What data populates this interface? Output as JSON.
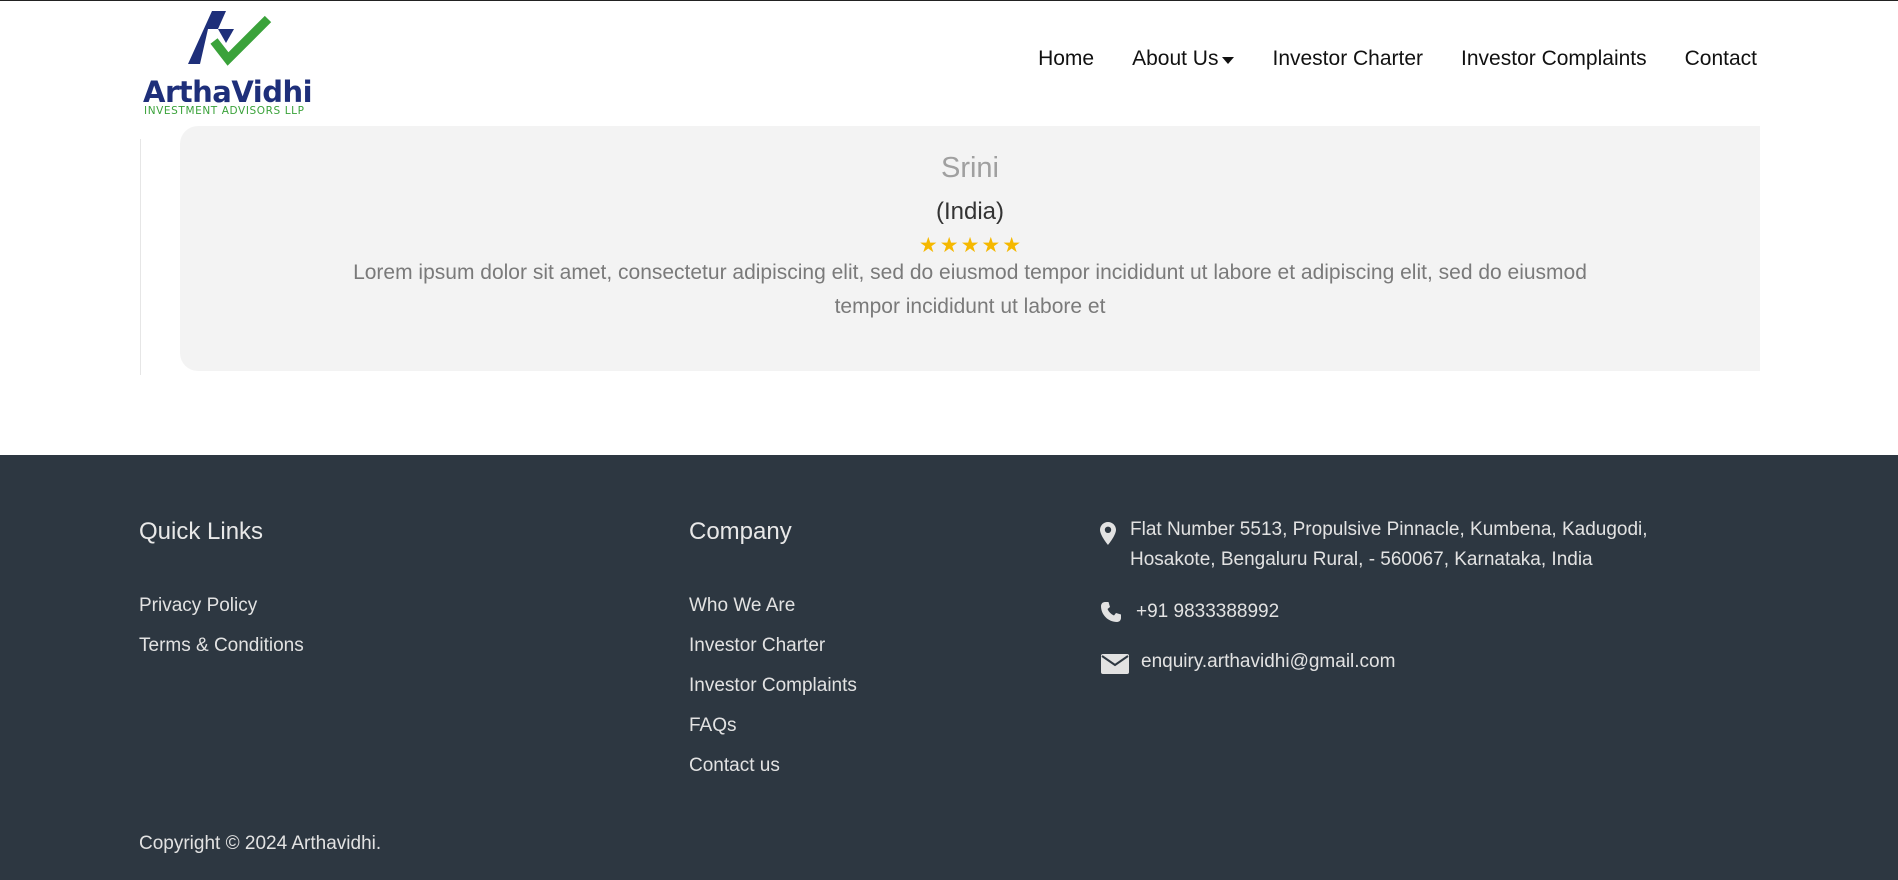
{
  "header": {
    "logo": {
      "name": "ArthaVidhi",
      "subtitle": "INVESTMENT ADVISORS LLP"
    },
    "nav": [
      {
        "label": "Home"
      },
      {
        "label": "About Us"
      },
      {
        "label": "Investor Charter"
      },
      {
        "label": "Investor Complaints"
      },
      {
        "label": "Contact"
      }
    ]
  },
  "testimonial": {
    "name": "Srini",
    "country": "(India)",
    "rating": 5,
    "text": "Lorem ipsum dolor sit amet, consectetur adipiscing elit, sed do eiusmod tempor incididunt ut labore et adipiscing elit, sed do eiusmod tempor incididunt ut labore et"
  },
  "footer": {
    "quick_links": {
      "title": "Quick Links",
      "items": [
        "Privacy Policy",
        "Terms & Conditions"
      ]
    },
    "company": {
      "title": "Company",
      "items": [
        "Who We Are",
        "Investor Charter",
        "Investor Complaints",
        "FAQs",
        "Contact us"
      ]
    },
    "contact": {
      "address": "Flat Number 5513, Propulsive Pinnacle, Kumbena, Kadugodi, Hosakote, Bengaluru Rural, - 560067, Karnataka, India",
      "phone": "+91 9833388992",
      "email": "enquiry.arthavidhi@gmail.com"
    },
    "copyright": "Copyright © 2024 Arthavidhi."
  },
  "colors": {
    "brand_navy": "#1e2f7a",
    "brand_green": "#3aa23a",
    "footer_bg": "#2d3741",
    "star": "#f5b800"
  },
  "icons": [
    "map-marker-icon",
    "phone-icon",
    "envelope-icon",
    "star-icon"
  ]
}
